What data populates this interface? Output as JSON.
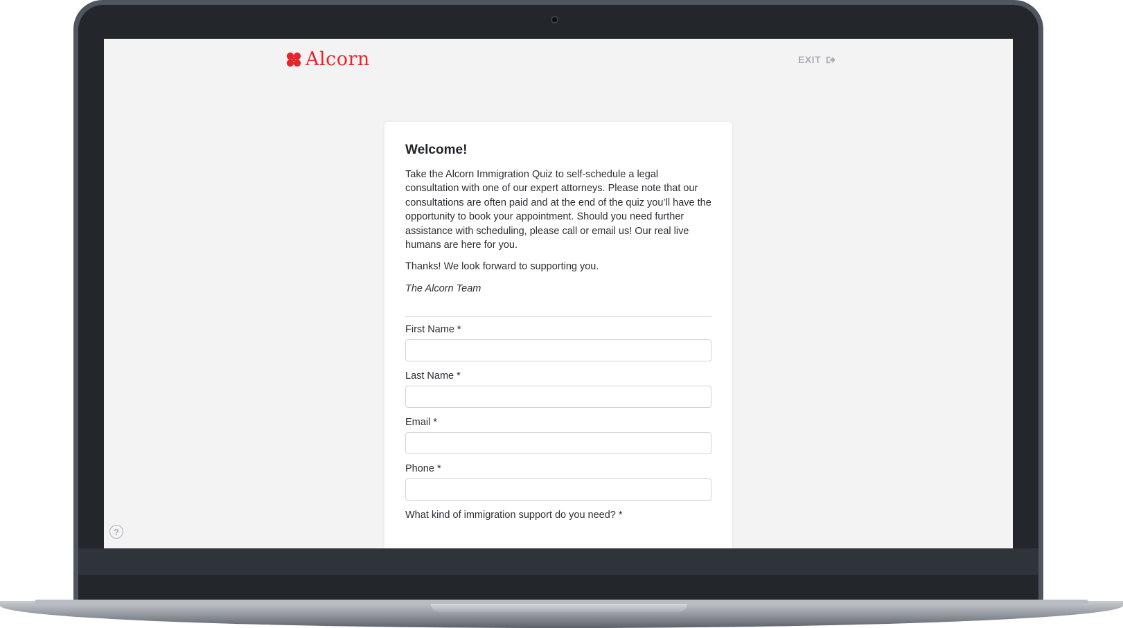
{
  "header": {
    "logo_text": "Alcorn",
    "exit_label": "EXIT",
    "brand_color": "#e3262b",
    "exit_icon": "exit-icon"
  },
  "help": {
    "glyph": "?",
    "icon": "help-circle-icon"
  },
  "card": {
    "title": "Welcome!",
    "intro": "Take the Alcorn Immigration Quiz to self-schedule a legal consultation with one of our expert attorneys. Please note that our consultations are often paid and at the end of the quiz you’ll have the opportunity to book your appointment. Should you need further assistance with scheduling, please call or email us! Our real live humans are here for you.",
    "thanks": "Thanks! We look forward to supporting you.",
    "signature": "The Alcorn Team"
  },
  "form": {
    "first_name_label": "First Name *",
    "first_name_value": "",
    "last_name_label": "Last Name *",
    "last_name_value": "",
    "email_label": "Email *",
    "email_value": "",
    "phone_label": "Phone *",
    "phone_value": "",
    "support_label": "What kind of immigration support do you need? *"
  }
}
